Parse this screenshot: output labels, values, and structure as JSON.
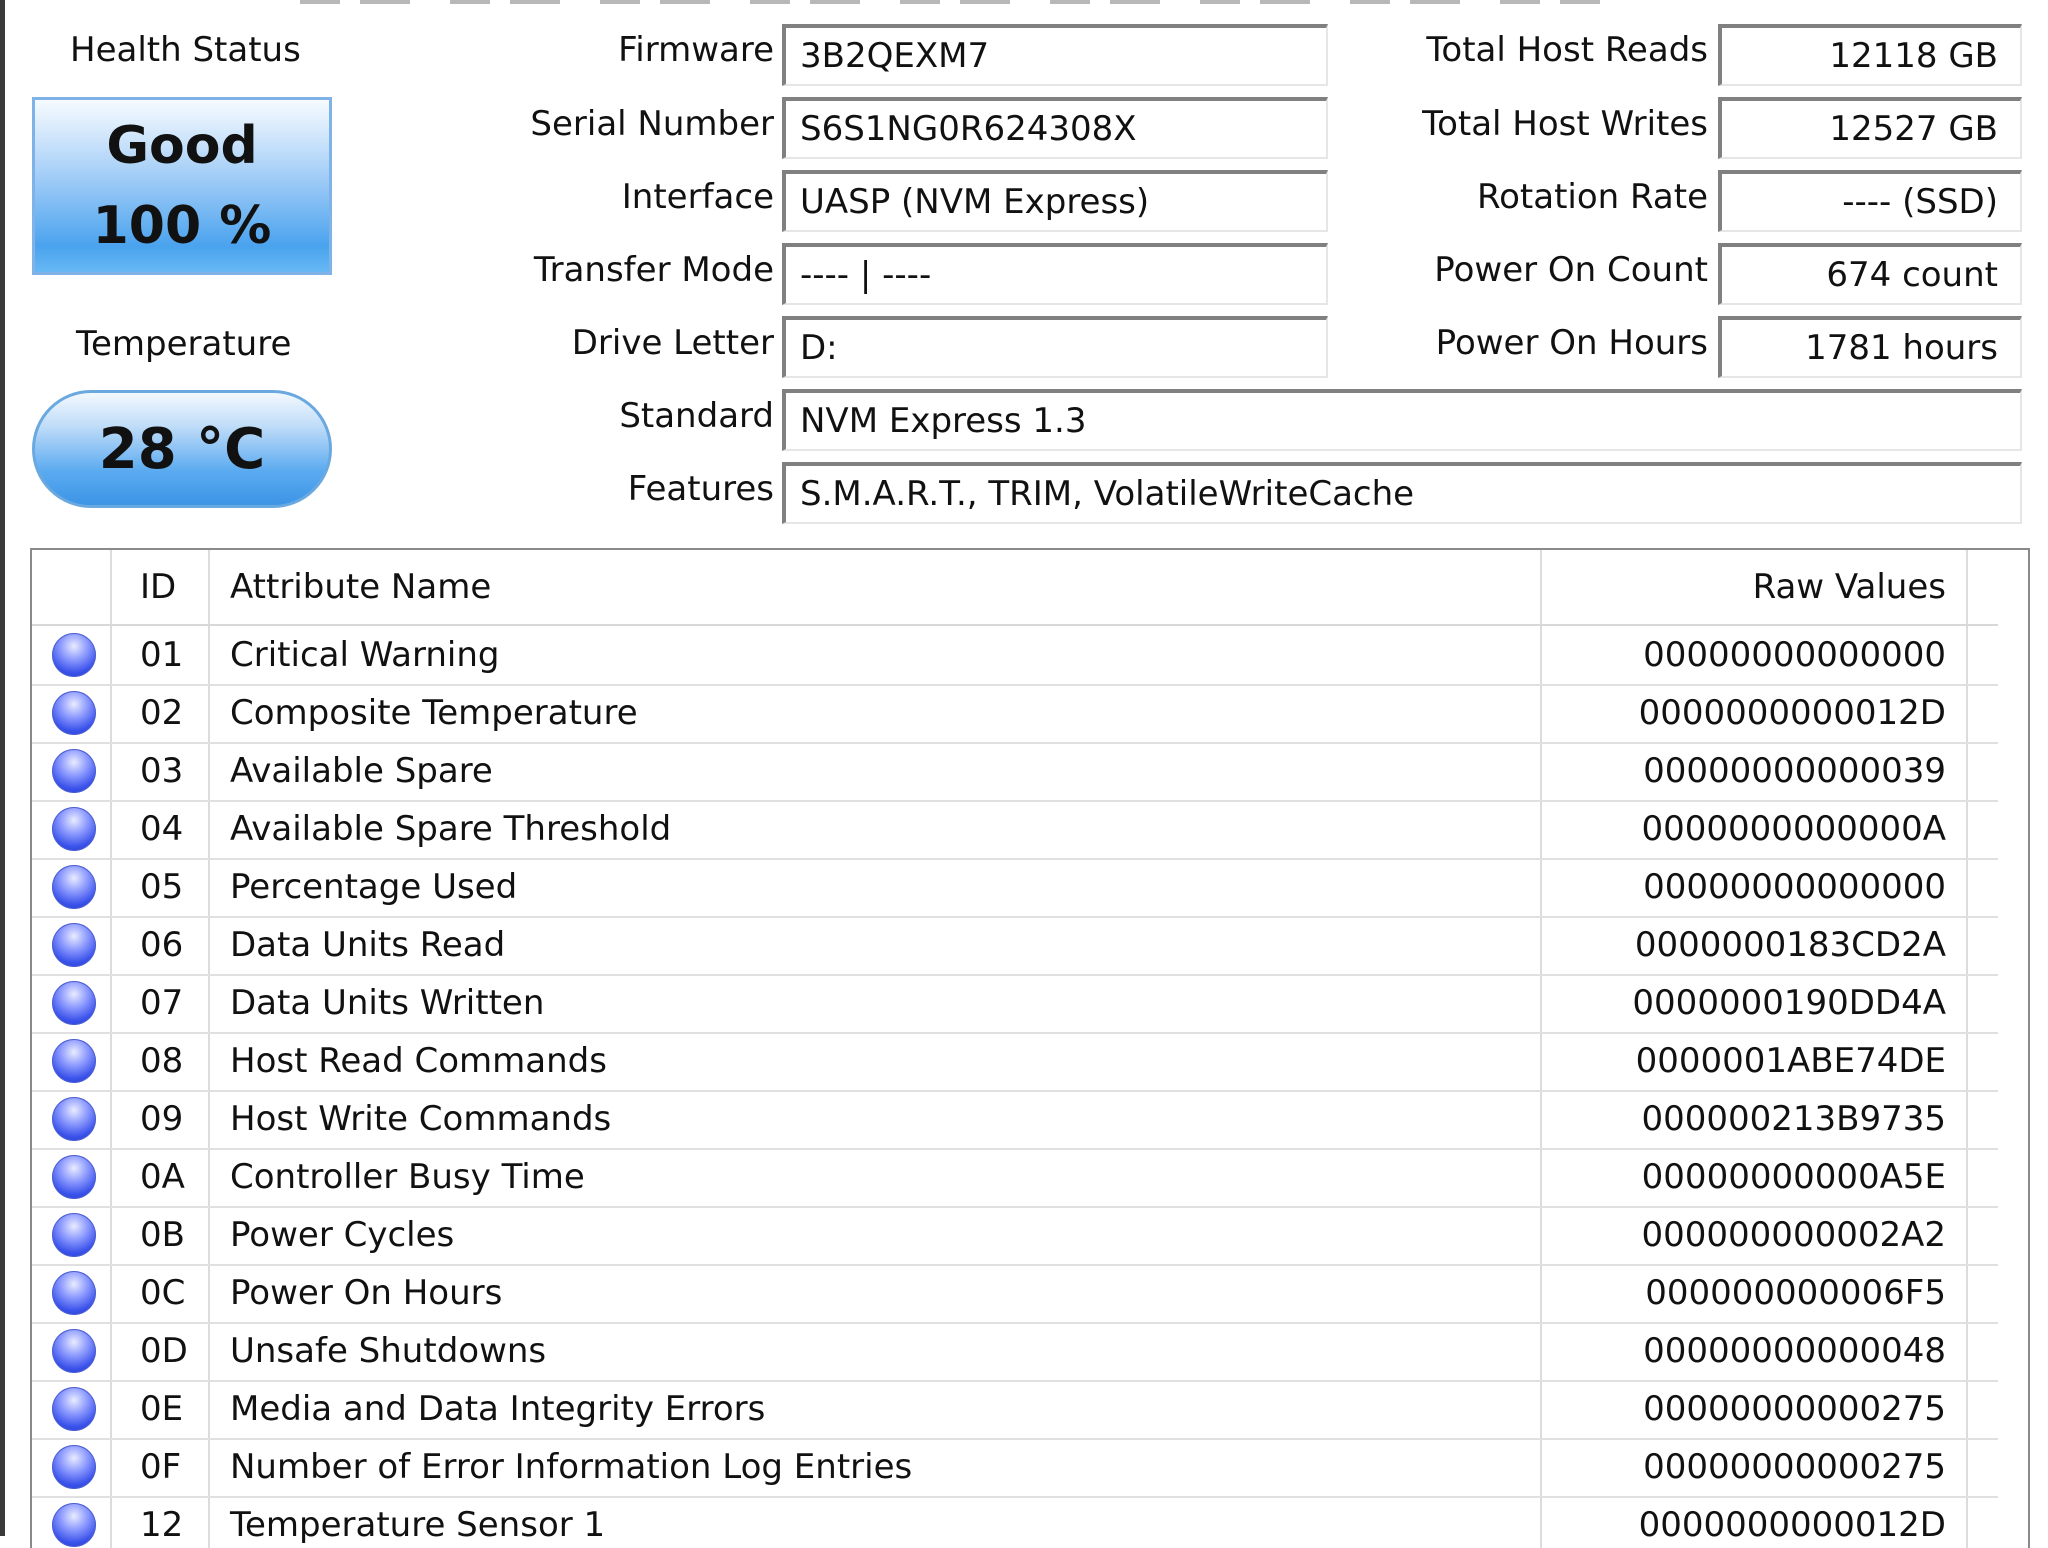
{
  "health": {
    "label": "Health Status",
    "status": "Good",
    "percent": "100 %"
  },
  "temperature": {
    "label": "Temperature",
    "value": "28 °C"
  },
  "info": {
    "firmware": {
      "label": "Firmware",
      "value": "3B2QEXM7"
    },
    "serial": {
      "label": "Serial Number",
      "value": "S6S1NG0R624308X"
    },
    "interface": {
      "label": "Interface",
      "value": "UASP (NVM Express)"
    },
    "transfer": {
      "label": "Transfer Mode",
      "value": "---- | ----"
    },
    "drive_letter": {
      "label": "Drive Letter",
      "value": "D:"
    },
    "standard": {
      "label": "Standard",
      "value": "NVM Express 1.3"
    },
    "features": {
      "label": "Features",
      "value": "S.M.A.R.T., TRIM, VolatileWriteCache"
    }
  },
  "stats": {
    "reads": {
      "label": "Total Host Reads",
      "value": "12118 GB"
    },
    "writes": {
      "label": "Total Host Writes",
      "value": "12527 GB"
    },
    "rotation": {
      "label": "Rotation Rate",
      "value": "---- (SSD)"
    },
    "power_count": {
      "label": "Power On Count",
      "value": "674 count"
    },
    "power_hours": {
      "label": "Power On Hours",
      "value": "1781 hours"
    }
  },
  "table": {
    "headers": {
      "id": "ID",
      "name": "Attribute Name",
      "raw": "Raw Values"
    },
    "rows": [
      {
        "id": "01",
        "name": "Critical Warning",
        "raw": "00000000000000"
      },
      {
        "id": "02",
        "name": "Composite Temperature",
        "raw": "0000000000012D"
      },
      {
        "id": "03",
        "name": "Available Spare",
        "raw": "00000000000039"
      },
      {
        "id": "04",
        "name": "Available Spare Threshold",
        "raw": "0000000000000A"
      },
      {
        "id": "05",
        "name": "Percentage Used",
        "raw": "00000000000000"
      },
      {
        "id": "06",
        "name": "Data Units Read",
        "raw": "0000000183CD2A"
      },
      {
        "id": "07",
        "name": "Data Units Written",
        "raw": "0000000190DD4A"
      },
      {
        "id": "08",
        "name": "Host Read Commands",
        "raw": "0000001ABE74DE"
      },
      {
        "id": "09",
        "name": "Host Write Commands",
        "raw": "000000213B9735"
      },
      {
        "id": "0A",
        "name": "Controller Busy Time",
        "raw": "00000000000A5E"
      },
      {
        "id": "0B",
        "name": "Power Cycles",
        "raw": "000000000002A2"
      },
      {
        "id": "0C",
        "name": "Power On Hours",
        "raw": "000000000006F5"
      },
      {
        "id": "0D",
        "name": "Unsafe Shutdowns",
        "raw": "00000000000048"
      },
      {
        "id": "0E",
        "name": "Media and Data Integrity Errors",
        "raw": "00000000000275"
      },
      {
        "id": "0F",
        "name": "Number of Error Information Log Entries",
        "raw": "00000000000275"
      },
      {
        "id": "12",
        "name": "Temperature Sensor 1",
        "raw": "0000000000012D"
      }
    ]
  }
}
